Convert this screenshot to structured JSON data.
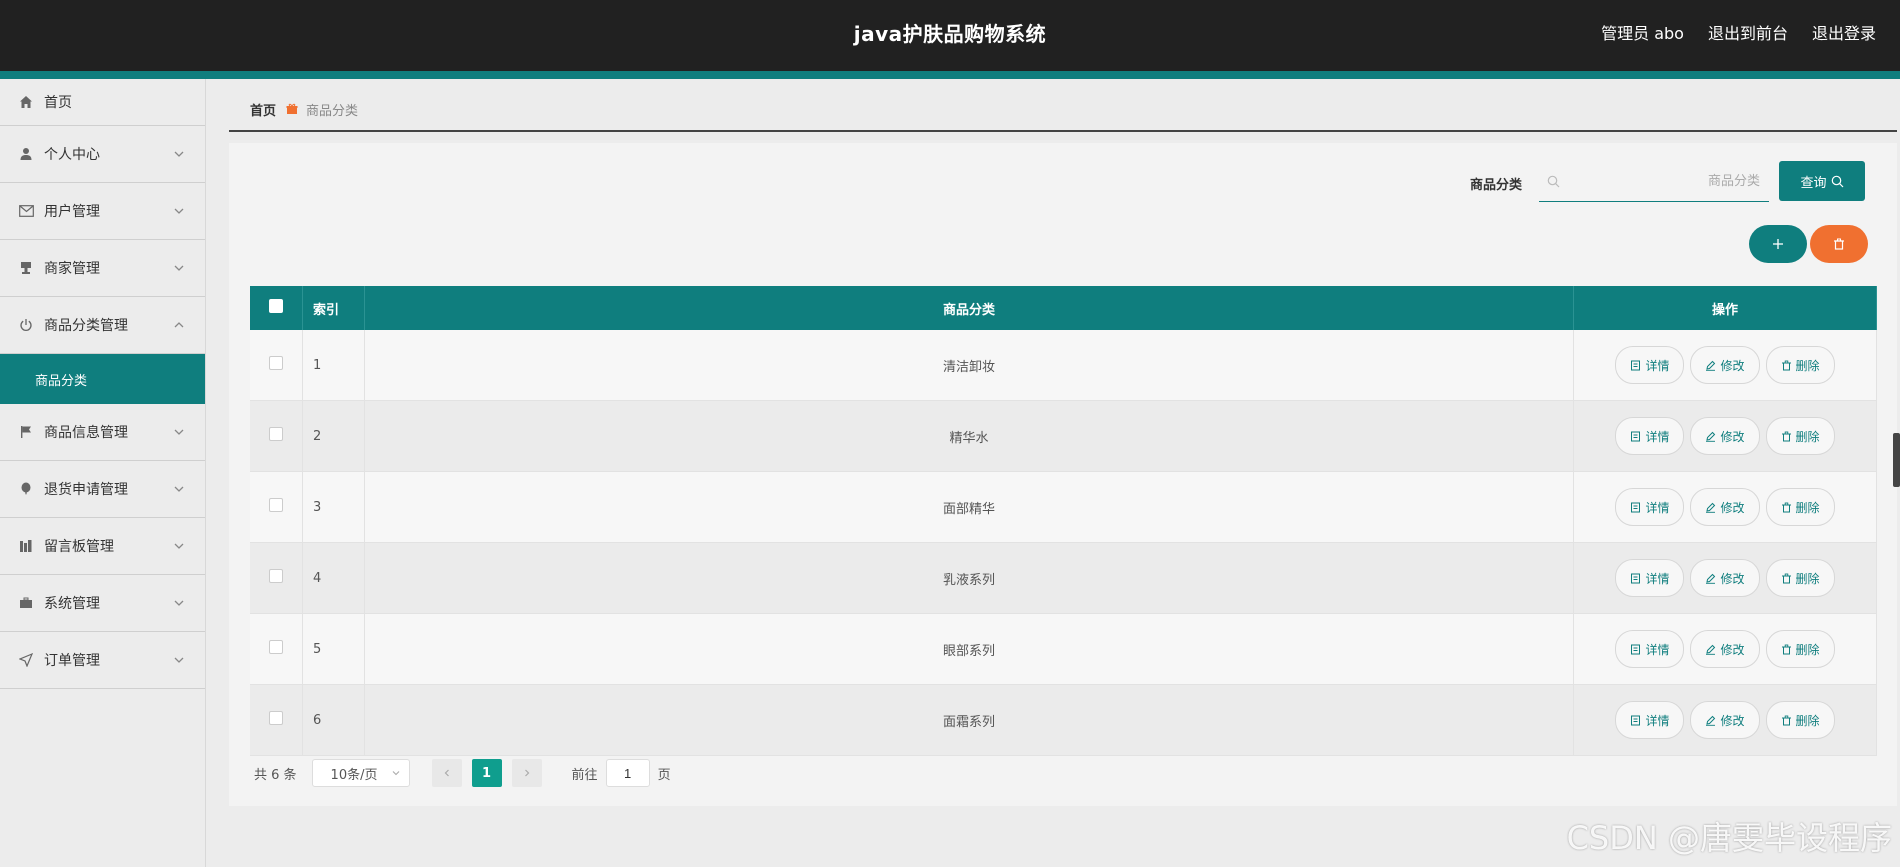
{
  "header": {
    "title": "java护肤品购物系统",
    "admin_label": "管理员 abo",
    "to_frontend": "退出到前台",
    "logout": "退出登录"
  },
  "sidebar": {
    "items": [
      {
        "label": "首页",
        "icon": "home-icon"
      },
      {
        "label": "个人中心",
        "icon": "user-icon"
      },
      {
        "label": "用户管理",
        "icon": "mail-icon"
      },
      {
        "label": "商家管理",
        "icon": "stamp-icon"
      },
      {
        "label": "商品分类管理",
        "icon": "power-icon",
        "expanded": true,
        "sub": "商品分类"
      },
      {
        "label": "商品信息管理",
        "icon": "flag-icon"
      },
      {
        "label": "退货申请管理",
        "icon": "balloon-icon"
      },
      {
        "label": "留言板管理",
        "icon": "books-icon"
      },
      {
        "label": "系统管理",
        "icon": "briefcase-icon"
      },
      {
        "label": "订单管理",
        "icon": "send-icon"
      }
    ]
  },
  "breadcrumb": {
    "home": "首页",
    "current": "商品分类"
  },
  "search": {
    "label": "商品分类",
    "placeholder": "商品分类",
    "query_button": "查询"
  },
  "table": {
    "headers": {
      "index": "索引",
      "name": "商品分类",
      "ops": "操作"
    },
    "rows": [
      {
        "index": "1",
        "name": "清洁卸妆"
      },
      {
        "index": "2",
        "name": "精华水"
      },
      {
        "index": "3",
        "name": "面部精华"
      },
      {
        "index": "4",
        "name": "乳液系列"
      },
      {
        "index": "5",
        "name": "眼部系列"
      },
      {
        "index": "6",
        "name": "面霜系列"
      }
    ],
    "actions": {
      "detail": "详情",
      "edit": "修改",
      "delete": "删除"
    }
  },
  "pagination": {
    "total": "共 6 条",
    "page_size": "10条/页",
    "current_page": "1",
    "goto_label": "前往",
    "goto_value": "1",
    "goto_suffix": "页"
  },
  "watermark": "CSDN @唐雯毕设程序",
  "colors": {
    "accent": "#0f7e7e",
    "danger": "#f07030",
    "header_bg": "#212121"
  }
}
